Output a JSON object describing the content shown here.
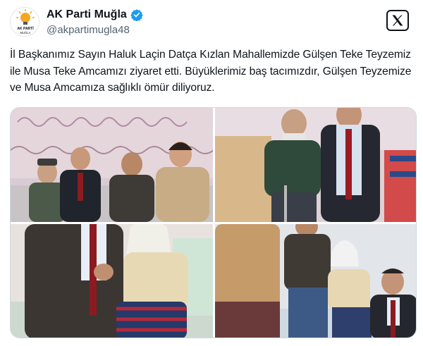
{
  "account": {
    "display_name": "AK Parti Muğla",
    "handle": "@akpartimugla48",
    "avatar_icon": "ak-parti-logo-icon",
    "avatar_text_top": "AK PARTİ",
    "avatar_text_bottom": "MUĞLA",
    "verified_icon": "verified-badge-icon",
    "verified_color": "#1d9bf0"
  },
  "platform_icon": "x-logo-icon",
  "tweet": {
    "text": "İl Başkanımız Sayın Haluk Laçin Datça Kızlan Mahallemizde Gülşen Teke Teyzemiz ile Musa Teke Amcamızı ziyaret etti. Büyüklerimiz baş tacımızdır, Gülşen Teyzemize ve Musa Amcamıza sağlıklı ömür diliyoruz."
  },
  "media": {
    "photo_count": 4,
    "border_color": "#cfd9de"
  }
}
